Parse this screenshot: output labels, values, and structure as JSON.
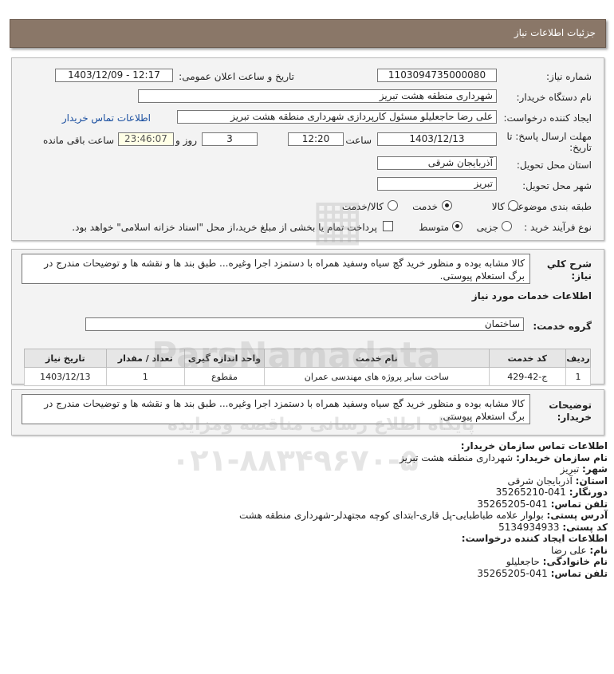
{
  "header": {
    "title": "جزئیات اطلاعات نیاز"
  },
  "form": {
    "need_number_label": "شماره نیاز:",
    "need_number": "1103094735000080",
    "announce_label": "تاریخ و ساعت اعلان عمومی:",
    "announce_value": "1403/12/09 - 12:17",
    "buyer_org_label": "نام دستگاه خریدار:",
    "buyer_org": "شهرداری منطقه هشت تبریز",
    "requester_label": "ایجاد کننده درخواست:",
    "requester": "علی رضا حاجعلیلو مسئول کارپردازی شهرداری منطقه هشت تبریز",
    "buyer_contact_link": "اطلاعات تماس خریدار",
    "deadline_label_1": "مهلت ارسال پاسخ: تا",
    "deadline_label_2": "تاریخ:",
    "deadline_date": "1403/12/13",
    "time_label": "ساعت",
    "deadline_time": "12:20",
    "days_value": "3",
    "days_label": "روز و",
    "remaining_time": "23:46:07",
    "remaining_label": "ساعت باقی مانده",
    "province_label": "استان محل تحویل:",
    "province": "آذربایجان شرقی",
    "city_label": "شهر محل تحویل:",
    "city": "تبریز",
    "category_label": "طبقه بندی موضوعی:",
    "category_options": [
      "کالا",
      "خدمت",
      "کالا/خدمت"
    ],
    "category_selected": "خدمت",
    "process_label": "نوع فرآیند خرید :",
    "process_options": [
      "جزیی",
      "متوسط"
    ],
    "process_selected": "متوسط",
    "payment_note": "پرداخت تمام یا بخشی از مبلغ خرید،از محل \"اسناد خزانه اسلامی\" خواهد بود."
  },
  "summary": {
    "label_1": "شرح کلي",
    "label_2": "نیاز:",
    "text": "کالا مشابه بوده و منظور خرید گچ سیاه وسفید همراه با دستمزد اجرا وغیره... طبق بند ها و نقشه ها و توضیحات مندرج در برگ استعلام پیوستی."
  },
  "services": {
    "section_title": "اطلاعات خدمات مورد نیاز",
    "group_label": "گروه خدمت:",
    "group_value": "ساختمان",
    "table": {
      "headers": [
        "ردیف",
        "کد خدمت",
        "نام خدمت",
        "واحد اندازه گیری",
        "تعداد / مقدار",
        "تاریخ نیاز"
      ],
      "rows": [
        [
          "1",
          "ج-42-429",
          "ساخت سایر پروژه های مهندسی عمران",
          "مقطوع",
          "1",
          "1403/12/13"
        ]
      ]
    }
  },
  "buyer_desc": {
    "label_1": "توضیحات",
    "label_2": "خریدار:",
    "text": "کالا مشابه بوده و منظور خرید گچ سیاه وسفید همراه با دستمزد اجرا وغیره... طبق بند ها و نقشه ها و توضیحات مندرج در برگ استعلام پیوستی."
  },
  "contact": {
    "title": "اطلاعات تماس سازمان خریدار:",
    "org_label": "نام سازمان خریدار:",
    "org": "شهرداری منطقه هشت تبریز",
    "city_label": "شهر:",
    "city": "تبریز",
    "province_label": "استان:",
    "province": "آذربایجان شرقی",
    "fax_label": "دورنگار:",
    "fax": "041-35265210",
    "phone_label": "تلفن تماس:",
    "phone": "041-35265205",
    "address_label": "آدرس پستی:",
    "address": "بولوار علامه طباطبایی-پل قاری-ابتدای کوچه مجتهدلر-شهرداری منطقه هشت",
    "postal_label": "کد پستی:",
    "postal": "5134934933",
    "creator_title": "اطلاعات ایجاد کننده درخواست:",
    "first_name_label": "نام:",
    "first_name": "علی رضا",
    "last_name_label": "نام خانوادگی:",
    "last_name": "حاجعلیلو",
    "creator_phone_label": "تلفن تماس:",
    "creator_phone": "041-35265205"
  },
  "watermark": {
    "brand": "ParsNamadata",
    "tagline": "پایگاه اطلاع رسانی مناقصه ومزایده",
    "phone": "۰۲۱-۸۸۳۴۹۶۷۰-۵"
  }
}
